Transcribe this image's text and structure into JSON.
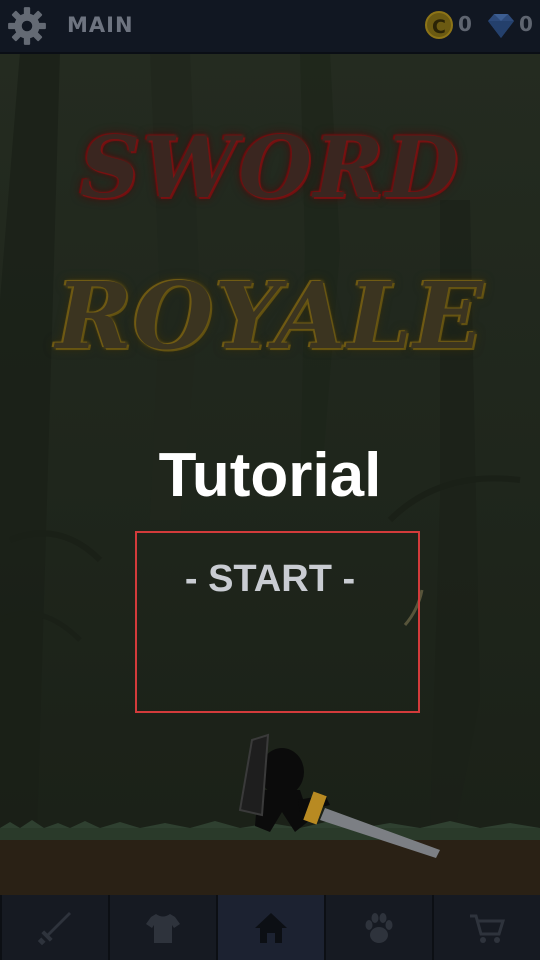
{
  "topbar": {
    "title": "MAIN",
    "settings_icon": "gear-icon",
    "coins": {
      "icon": "coin-icon",
      "glyph": "C",
      "count": "0"
    },
    "gems": {
      "icon": "diamond-icon",
      "count": "0"
    }
  },
  "logo": {
    "line1": "SWORD",
    "line2": "ROYALE"
  },
  "menu": {
    "mode": "Tutorial",
    "start_label": "- START -"
  },
  "nav": [
    {
      "icon": "sword-icon",
      "active": false
    },
    {
      "icon": "shirt-icon",
      "active": false
    },
    {
      "icon": "home-icon",
      "active": true
    },
    {
      "icon": "paw-icon",
      "active": false
    },
    {
      "icon": "cart-icon",
      "active": false
    }
  ],
  "colors": {
    "background": "#1c2219",
    "topbar": "#111722",
    "start_highlight": "#d33b3b",
    "coin": "#8d7417"
  }
}
